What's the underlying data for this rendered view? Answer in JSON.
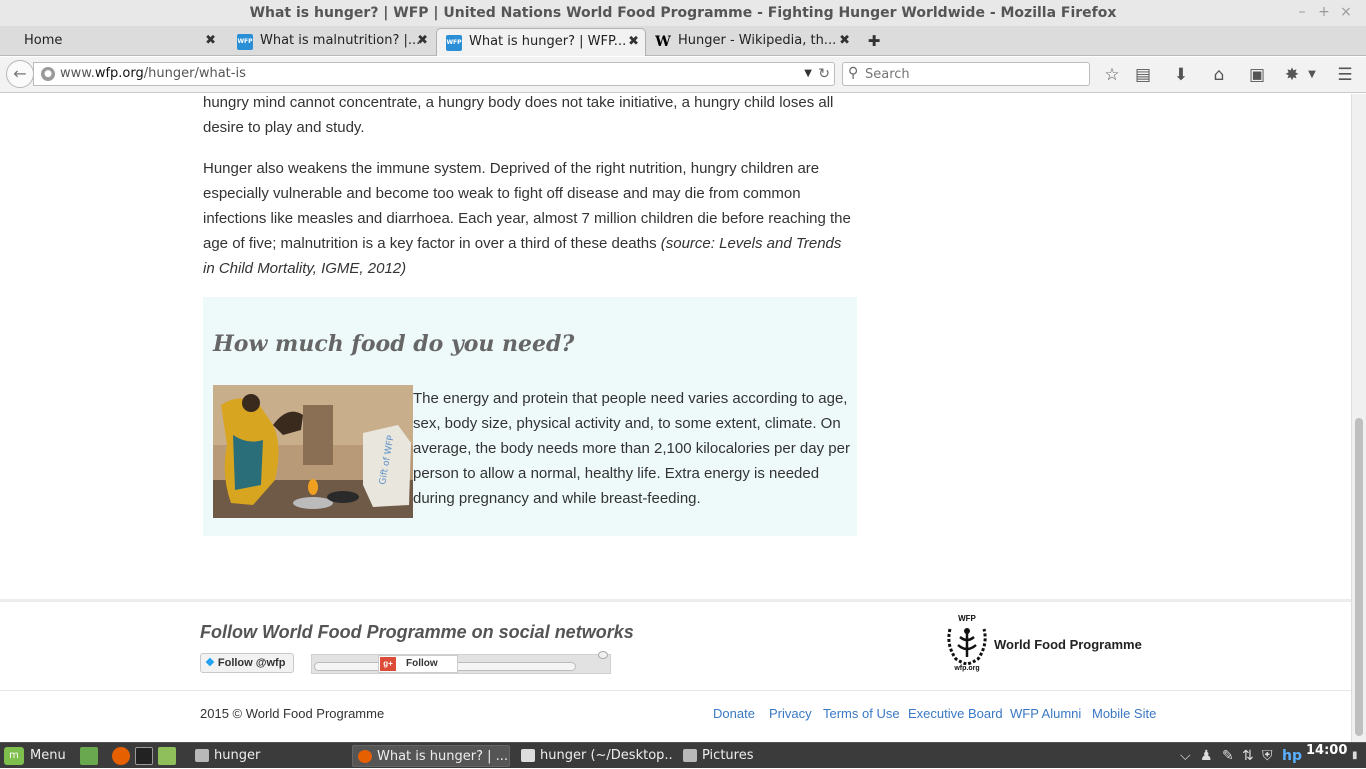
{
  "window": {
    "title": "What is hunger? | WFP | United Nations World Food Programme - Fighting Hunger Worldwide - Mozilla Firefox"
  },
  "tabs": [
    {
      "label": "Home",
      "favicon": "none"
    },
    {
      "label": "What is malnutrition? |...",
      "favicon": "wfp"
    },
    {
      "label": "What is hunger? | WFP...",
      "favicon": "wfp",
      "active": true
    },
    {
      "label": "Hunger - Wikipedia, th...",
      "favicon": "wikipedia"
    }
  ],
  "favicon_texts": {
    "wfp": "WFP",
    "wiki": "W"
  },
  "navbar": {
    "url_prefix": "www.",
    "url_domain": "wfp.org",
    "url_path": "/hunger/what-is",
    "search_placeholder": "Search"
  },
  "article": {
    "p1": "hungry mind cannot concentrate, a hungry body does not take initiative, a hungry child loses all desire to play and study.",
    "p2_main": "Hunger also weakens the immune system. Deprived of the right nutrition, hungry children are especially vulnerable and become too weak to fight off disease and may die from common infections like measles and diarrhoea. Each year, almost 7 million children die before reaching the age of five; malnutrition is a key factor in over a third of these deaths ",
    "p2_source": "(source: Levels and Trends in Child Mortality, IGME, 2012)"
  },
  "box": {
    "heading": "How much food do you need?",
    "text": "The energy and protein that people need varies according to age, sex, body size, physical activity and, to some extent, climate. On average, the body needs more than 2,100 kilocalories per day per person to allow a normal, healthy life. Extra energy is needed during pregnancy and while breast-feeding.",
    "photo_sack_text": "Gift of WFP"
  },
  "footer": {
    "follow_title": "Follow World Food Programme on social networks",
    "twitter_label": "Follow @wfp",
    "gplus_label": "Follow",
    "gplus_icon": "g+",
    "logo_top": "WFP",
    "logo_bottom": "wfp.org",
    "org_name": "World Food Programme",
    "copyright": "2015 © World Food Programme",
    "links": [
      "Donate",
      "Privacy",
      "Terms of Use",
      "Executive Board",
      "WFP Alumni",
      "Mobile Site"
    ]
  },
  "taskbar": {
    "menu_label": "Menu",
    "tasks": [
      {
        "label": "hunger",
        "icon": "folder-icon"
      },
      {
        "label": "What is hunger? | ...",
        "icon": "firefox-icon",
        "active": true
      },
      {
        "label": "hunger (~/Desktop...",
        "icon": "text-editor-icon"
      },
      {
        "label": "Pictures",
        "icon": "folder-icon"
      }
    ],
    "clock": "14:00"
  },
  "colors": {
    "link": "#3a78c3",
    "box_bg": "#eefafa",
    "wfp_blue": "#2b8fd8"
  }
}
